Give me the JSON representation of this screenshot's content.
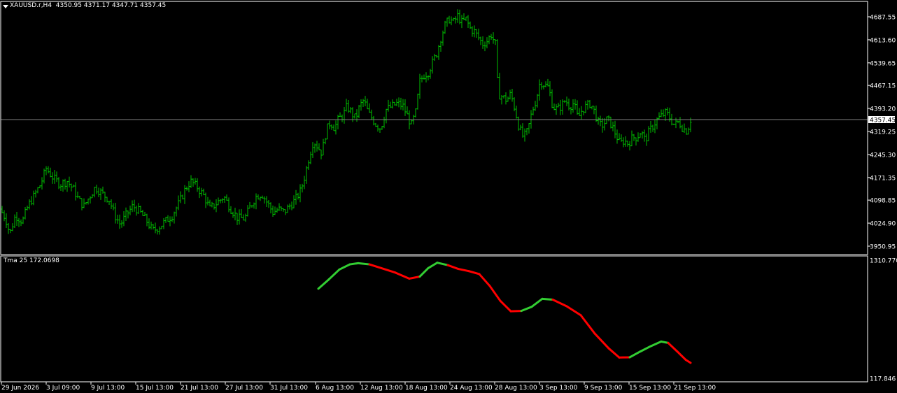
{
  "main_chart": {
    "symbol_timeframe": "XAUUSD.r,H4",
    "ohlc": "4350.95 4371.17 4347.71 4357.45",
    "current_price_label": "4357.45",
    "colors": {
      "bars": "#00c000",
      "background": "#000000",
      "grid": "#ffffff",
      "current_line": "#808080"
    }
  },
  "indicator": {
    "label": "Tma 25 172.0698",
    "colors": {
      "up": "#32cd32",
      "down": "#ff0000"
    }
  },
  "chart_data": [
    {
      "type": "ohlc",
      "title": "XAUUSD.r,H4",
      "y_ticks": [
        "4687.55",
        "4613.60",
        "4539.65",
        "4467.15",
        "4393.20",
        "4319.25",
        "4245.30",
        "4171.35",
        "4098.85",
        "4024.90",
        "3950.95"
      ],
      "x_ticks": [
        "29 Jun 2026",
        "3 Jul 09:00",
        "9 Jul 13:00",
        "15 Jul 13:00",
        "21 Jul 13:00",
        "27 Jul 13:00",
        "31 Jul 13:00",
        "6 Aug 13:00",
        "12 Aug 13:00",
        "18 Aug 13:00",
        "24 Aug 13:00",
        "28 Aug 13:00",
        "3 Sep 13:00",
        "9 Sep 13:00",
        "15 Sep 13:00",
        "21 Sep 13:00"
      ],
      "ylim": [
        3935,
        4702
      ],
      "current_price": 4357.45,
      "close_path": [
        [
          0,
          4070
        ],
        [
          8,
          4040
        ],
        [
          14,
          3990
        ],
        [
          22,
          4050
        ],
        [
          32,
          4030
        ],
        [
          40,
          4080
        ],
        [
          48,
          4110
        ],
        [
          58,
          4150
        ],
        [
          66,
          4200
        ],
        [
          76,
          4170
        ],
        [
          86,
          4150
        ],
        [
          96,
          4160
        ],
        [
          106,
          4130
        ],
        [
          112,
          4100
        ],
        [
          120,
          4080
        ],
        [
          128,
          4110
        ],
        [
          136,
          4140
        ],
        [
          146,
          4120
        ],
        [
          156,
          4100
        ],
        [
          164,
          4050
        ],
        [
          172,
          4020
        ],
        [
          180,
          4050
        ],
        [
          190,
          4080
        ],
        [
          200,
          4060
        ],
        [
          210,
          4030
        ],
        [
          218,
          4000
        ],
        [
          226,
          4010
        ],
        [
          236,
          4030
        ],
        [
          246,
          4050
        ],
        [
          256,
          4090
        ],
        [
          264,
          4130
        ],
        [
          272,
          4160
        ],
        [
          282,
          4140
        ],
        [
          292,
          4110
        ],
        [
          300,
          4070
        ],
        [
          310,
          4090
        ],
        [
          320,
          4110
        ],
        [
          330,
          4070
        ],
        [
          340,
          4040
        ],
        [
          350,
          4040
        ],
        [
          358,
          4080
        ],
        [
          366,
          4110
        ],
        [
          374,
          4120
        ],
        [
          382,
          4090
        ],
        [
          390,
          4060
        ],
        [
          398,
          4070
        ],
        [
          406,
          4060
        ],
        [
          414,
          4080
        ],
        [
          422,
          4100
        ],
        [
          430,
          4130
        ],
        [
          436,
          4180
        ],
        [
          442,
          4240
        ],
        [
          448,
          4290
        ],
        [
          454,
          4270
        ],
        [
          460,
          4250
        ],
        [
          466,
          4320
        ],
        [
          472,
          4350
        ],
        [
          478,
          4330
        ],
        [
          484,
          4360
        ],
        [
          490,
          4370
        ],
        [
          496,
          4400
        ],
        [
          502,
          4380
        ],
        [
          508,
          4360
        ],
        [
          514,
          4400
        ],
        [
          520,
          4420
        ],
        [
          526,
          4380
        ],
        [
          532,
          4360
        ],
        [
          538,
          4340
        ],
        [
          544,
          4330
        ],
        [
          552,
          4390
        ],
        [
          560,
          4400
        ],
        [
          568,
          4410
        ],
        [
          576,
          4400
        ],
        [
          582,
          4370
        ],
        [
          588,
          4340
        ],
        [
          594,
          4380
        ],
        [
          600,
          4480
        ],
        [
          606,
          4500
        ],
        [
          612,
          4510
        ],
        [
          618,
          4540
        ],
        [
          624,
          4570
        ],
        [
          630,
          4620
        ],
        [
          636,
          4660
        ],
        [
          642,
          4680
        ],
        [
          648,
          4670
        ],
        [
          654,
          4690
        ],
        [
          660,
          4670
        ],
        [
          666,
          4680
        ],
        [
          672,
          4650
        ],
        [
          678,
          4640
        ],
        [
          684,
          4620
        ],
        [
          690,
          4600
        ],
        [
          696,
          4610
        ],
        [
          702,
          4630
        ],
        [
          708,
          4600
        ],
        [
          712,
          4440
        ],
        [
          718,
          4430
        ],
        [
          724,
          4420
        ],
        [
          730,
          4440
        ],
        [
          736,
          4390
        ],
        [
          742,
          4330
        ],
        [
          748,
          4300
        ],
        [
          754,
          4320
        ],
        [
          760,
          4380
        ],
        [
          766,
          4420
        ],
        [
          772,
          4480
        ],
        [
          778,
          4470
        ],
        [
          784,
          4460
        ],
        [
          790,
          4400
        ],
        [
          796,
          4390
        ],
        [
          802,
          4400
        ],
        [
          808,
          4420
        ],
        [
          814,
          4400
        ],
        [
          820,
          4410
        ],
        [
          826,
          4360
        ],
        [
          832,
          4390
        ],
        [
          838,
          4400
        ],
        [
          844,
          4410
        ],
        [
          850,
          4380
        ],
        [
          856,
          4340
        ],
        [
          862,
          4340
        ],
        [
          868,
          4360
        ],
        [
          874,
          4340
        ],
        [
          880,
          4310
        ],
        [
          886,
          4280
        ],
        [
          892,
          4290
        ],
        [
          898,
          4280
        ],
        [
          904,
          4300
        ],
        [
          910,
          4300
        ],
        [
          916,
          4320
        ],
        [
          922,
          4290
        ],
        [
          928,
          4320
        ],
        [
          934,
          4340
        ],
        [
          940,
          4360
        ],
        [
          946,
          4370
        ],
        [
          952,
          4380
        ],
        [
          958,
          4360
        ],
        [
          964,
          4340
        ],
        [
          970,
          4350
        ],
        [
          976,
          4330
        ],
        [
          982,
          4320
        ],
        [
          987,
          4357
        ]
      ]
    },
    {
      "type": "line",
      "title": "Tma 25 172.0698",
      "y_ticks": [
        "1310.7702",
        "117.846"
      ],
      "ylim": [
        117.846,
        1310.7702
      ],
      "series": [
        {
          "name": "Tma 25",
          "points": [
            [
              455,
              1022
            ],
            [
              470,
              1116
            ],
            [
              485,
              1216
            ],
            [
              500,
              1268
            ],
            [
              512,
              1280
            ],
            [
              528,
              1268
            ],
            [
              545,
              1230
            ],
            [
              565,
              1185
            ],
            [
              585,
              1124
            ],
            [
              600,
              1145
            ],
            [
              612,
              1230
            ],
            [
              625,
              1285
            ],
            [
              640,
              1260
            ],
            [
              655,
              1222
            ],
            [
              670,
              1200
            ],
            [
              685,
              1170
            ],
            [
              700,
              1050
            ],
            [
              715,
              900
            ],
            [
              730,
              795
            ],
            [
              745,
              798
            ],
            [
              760,
              840
            ],
            [
              775,
              920
            ],
            [
              790,
              912
            ],
            [
              810,
              845
            ],
            [
              830,
              755
            ],
            [
              850,
              570
            ],
            [
              870,
              420
            ],
            [
              885,
              328
            ],
            [
              900,
              330
            ],
            [
              915,
              388
            ],
            [
              930,
              442
            ],
            [
              945,
              489
            ],
            [
              955,
              475
            ],
            [
              968,
              388
            ],
            [
              980,
              305
            ],
            [
              987,
              274
            ]
          ],
          "trend": [
            "up",
            "up",
            "up",
            "up",
            "up",
            "down",
            "down",
            "down",
            "down",
            "up",
            "up",
            "up",
            "down",
            "down",
            "down",
            "down",
            "down",
            "down",
            "down",
            "up",
            "up",
            "up",
            "down",
            "down",
            "down",
            "down",
            "down",
            "down",
            "up",
            "up",
            "up",
            "up",
            "down",
            "down",
            "down",
            "down"
          ]
        }
      ]
    }
  ]
}
